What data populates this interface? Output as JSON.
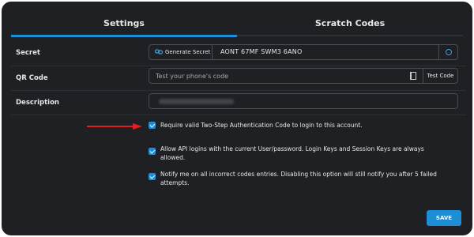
{
  "tabs": [
    {
      "label": "Settings",
      "active": true
    },
    {
      "label": "Scratch Codes",
      "active": false
    }
  ],
  "secret": {
    "label": "Secret",
    "generate_button": "Generate Secret",
    "value": "AONT 67MF SWM3 6ANO"
  },
  "qr_code": {
    "label": "QR Code",
    "placeholder": "Test your phone's code",
    "test_button": "Test Code"
  },
  "description": {
    "label": "Description"
  },
  "options": [
    {
      "checked": true,
      "text": "Require valid Two-Step Authentication Code to login to this account."
    },
    {
      "checked": true,
      "text": "Allow API logins with the current User/password. Login Keys and Session Keys are always allowed."
    },
    {
      "checked": true,
      "text": "Notify me on all incorrect codes entries. Disabling this option will still notify you after 5 failed attempts."
    }
  ],
  "save_label": "SAVE",
  "colors": {
    "background": "#1f2024",
    "accent": "#1d8ed6",
    "annotation_arrow": "#e02020"
  }
}
